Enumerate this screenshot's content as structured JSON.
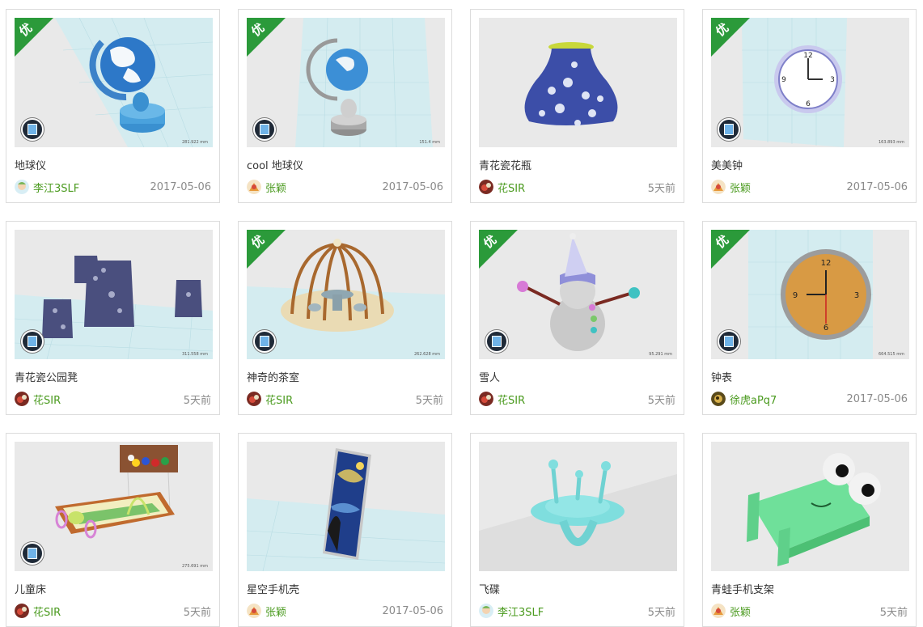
{
  "colors": {
    "author": "#4a9a1e",
    "badge": "#2b9a3a",
    "date": "#8a8a8a"
  },
  "badge_label": "优",
  "cards": [
    {
      "title": "地球仪",
      "author": "李江3SLF",
      "date": "2017-05-06",
      "featured": true,
      "scale": "281.922 mm"
    },
    {
      "title": "cool 地球仪",
      "author": "张颖",
      "date": "2017-05-06",
      "featured": true,
      "scale": "151.4 mm"
    },
    {
      "title": "青花瓷花瓶",
      "author": "花SIR",
      "date": "5天前",
      "featured": false,
      "scale": ""
    },
    {
      "title": "美美钟",
      "author": "张颖",
      "date": "2017-05-06",
      "featured": true,
      "scale": "163.893 mm"
    },
    {
      "title": "青花瓷公园凳",
      "author": "花SIR",
      "date": "5天前",
      "featured": false,
      "scale": "311.558 mm"
    },
    {
      "title": "神奇的茶室",
      "author": "花SIR",
      "date": "5天前",
      "featured": true,
      "scale": "262.628 mm"
    },
    {
      "title": "雪人",
      "author": "花SIR",
      "date": "5天前",
      "featured": true,
      "scale": "95.291 mm"
    },
    {
      "title": "钟表",
      "author": "徐虎aPq7",
      "date": "2017-05-06",
      "featured": true,
      "scale": "664.515 mm"
    },
    {
      "title": "儿童床",
      "author": "花SIR",
      "date": "5天前",
      "featured": false,
      "scale": "275.691 mm"
    },
    {
      "title": "星空手机壳",
      "author": "张颖",
      "date": "2017-05-06",
      "featured": false,
      "scale": ""
    },
    {
      "title": "飞碟",
      "author": "李江3SLF",
      "date": "5天前",
      "featured": false,
      "scale": ""
    },
    {
      "title": "青蛙手机支架",
      "author": "张颖",
      "date": "5天前",
      "featured": false,
      "scale": ""
    }
  ]
}
